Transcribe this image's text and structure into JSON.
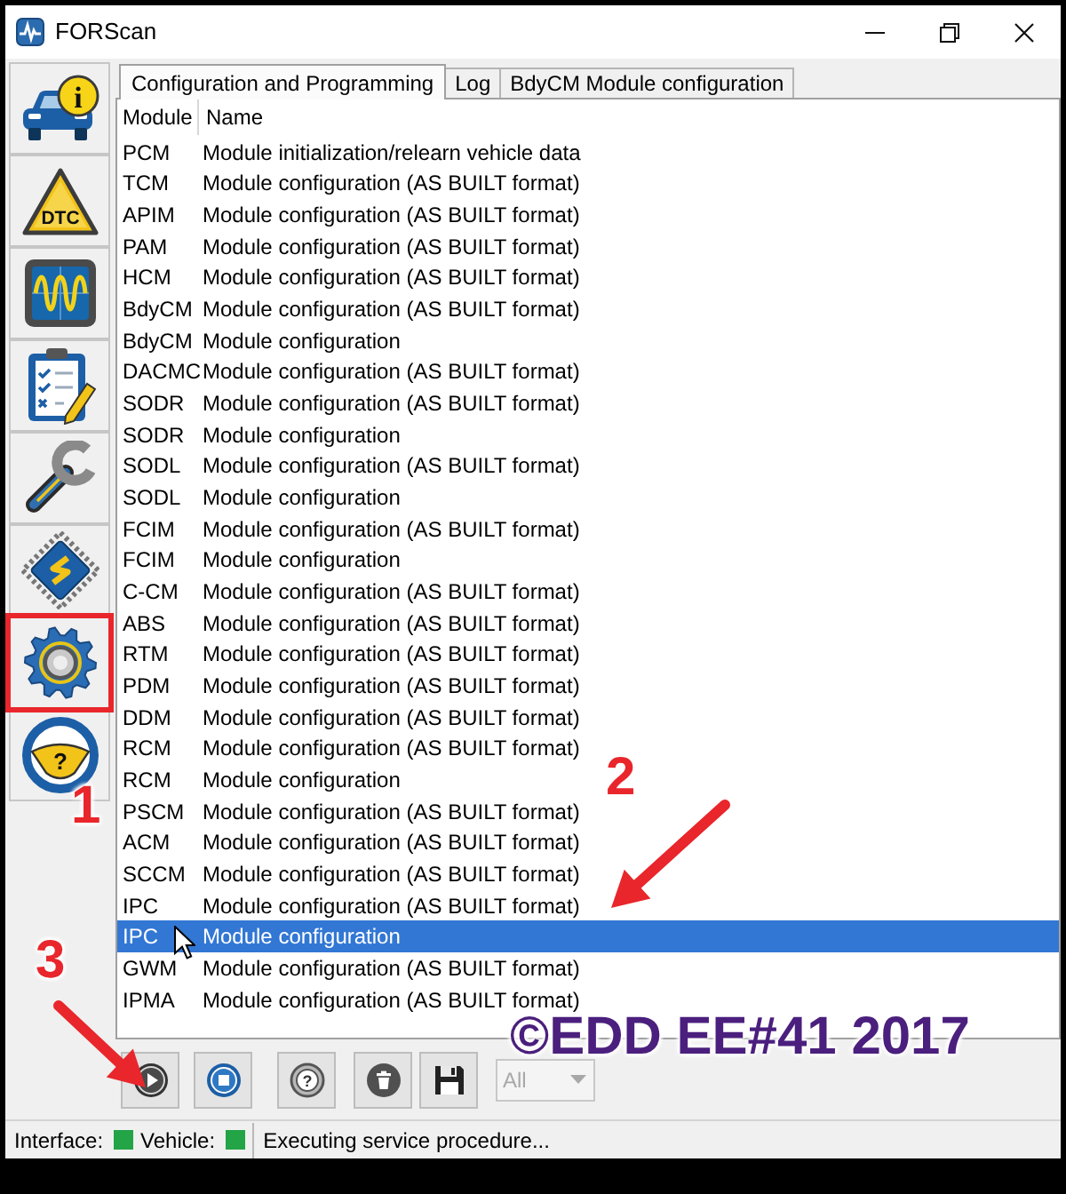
{
  "window": {
    "title": "FORScan"
  },
  "sidebar": {
    "items": [
      {
        "kind": "info",
        "label": "i",
        "highlighted": false
      },
      {
        "kind": "dtc",
        "label": "DTC",
        "highlighted": false
      },
      {
        "kind": "oscilloscope",
        "highlighted": false
      },
      {
        "kind": "checklist",
        "highlighted": false
      },
      {
        "kind": "wrench",
        "highlighted": false
      },
      {
        "kind": "chip",
        "highlighted": false
      },
      {
        "kind": "gear",
        "highlighted": true
      },
      {
        "kind": "steering",
        "label": "?",
        "highlighted": false
      }
    ]
  },
  "tabs": [
    {
      "label": "Configuration and Programming",
      "selected": true
    },
    {
      "label": "Log",
      "selected": false
    },
    {
      "label": "BdyCM Module configuration",
      "selected": false
    }
  ],
  "table": {
    "columns": [
      "Module",
      "Name"
    ],
    "rows": [
      {
        "module": "PCM",
        "name": "Module initialization/relearn vehicle data",
        "selected": false
      },
      {
        "module": "TCM",
        "name": "Module configuration (AS BUILT format)",
        "selected": false
      },
      {
        "module": "APIM",
        "name": "Module configuration (AS BUILT format)",
        "selected": false
      },
      {
        "module": "PAM",
        "name": "Module configuration (AS BUILT format)",
        "selected": false
      },
      {
        "module": "HCM",
        "name": "Module configuration (AS BUILT format)",
        "selected": false
      },
      {
        "module": "BdyCM",
        "name": "Module configuration (AS BUILT format)",
        "selected": false
      },
      {
        "module": "BdyCM",
        "name": "Module configuration",
        "selected": false
      },
      {
        "module": "DACMC",
        "name": "Module configuration (AS BUILT format)",
        "selected": false
      },
      {
        "module": "SODR",
        "name": "Module configuration (AS BUILT format)",
        "selected": false
      },
      {
        "module": "SODR",
        "name": "Module configuration",
        "selected": false
      },
      {
        "module": "SODL",
        "name": "Module configuration (AS BUILT format)",
        "selected": false
      },
      {
        "module": "SODL",
        "name": "Module configuration",
        "selected": false
      },
      {
        "module": "FCIM",
        "name": "Module configuration (AS BUILT format)",
        "selected": false
      },
      {
        "module": "FCIM",
        "name": "Module configuration",
        "selected": false
      },
      {
        "module": "C-CM",
        "name": "Module configuration (AS BUILT format)",
        "selected": false
      },
      {
        "module": "ABS",
        "name": "Module configuration (AS BUILT format)",
        "selected": false
      },
      {
        "module": "RTM",
        "name": "Module configuration (AS BUILT format)",
        "selected": false
      },
      {
        "module": "PDM",
        "name": "Module configuration (AS BUILT format)",
        "selected": false
      },
      {
        "module": "DDM",
        "name": "Module configuration (AS BUILT format)",
        "selected": false
      },
      {
        "module": "RCM",
        "name": "Module configuration (AS BUILT format)",
        "selected": false
      },
      {
        "module": "RCM",
        "name": "Module configuration",
        "selected": false
      },
      {
        "module": "PSCM",
        "name": "Module configuration (AS BUILT format)",
        "selected": false
      },
      {
        "module": "ACM",
        "name": "Module configuration (AS BUILT format)",
        "selected": false
      },
      {
        "module": "SCCM",
        "name": "Module configuration (AS BUILT format)",
        "selected": false
      },
      {
        "module": "IPC",
        "name": "Module configuration (AS BUILT format)",
        "selected": false
      },
      {
        "module": "IPC",
        "name": "Module configuration",
        "selected": true
      },
      {
        "module": "GWM",
        "name": "Module configuration (AS BUILT format)",
        "selected": false
      },
      {
        "module": "IPMA",
        "name": "Module configuration (AS BUILT format)",
        "selected": false
      }
    ]
  },
  "toolbar": {
    "buttons": [
      {
        "kind": "play"
      },
      {
        "kind": "stop"
      },
      {
        "kind": "help",
        "label": "?"
      },
      {
        "kind": "delete"
      },
      {
        "kind": "save"
      }
    ],
    "filter": {
      "value": "All",
      "disabled": true
    }
  },
  "status_bar": {
    "indicators": [
      {
        "label": "Interface:",
        "color": "#22a447"
      },
      {
        "label": "Vehicle:",
        "color": "#22a447"
      }
    ],
    "message": "Executing service procedure..."
  },
  "annotations": [
    {
      "kind": "number",
      "text": "1"
    },
    {
      "kind": "arrow_number",
      "text": "2"
    },
    {
      "kind": "arrow_number",
      "text": "3"
    },
    {
      "kind": "caption",
      "text": "©EDD EE#41 2017"
    }
  ]
}
